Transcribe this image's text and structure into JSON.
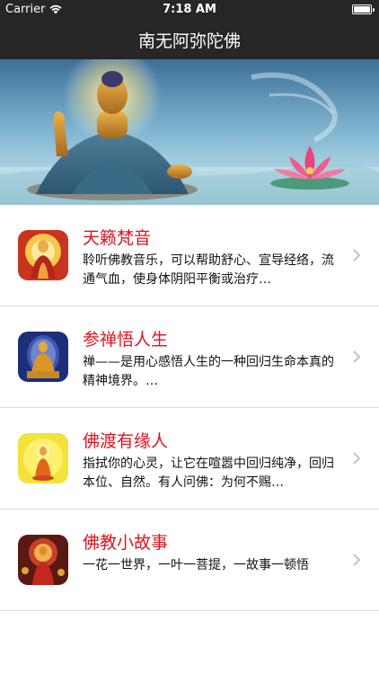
{
  "status": {
    "carrier": "Carrier",
    "time": "7:18 AM"
  },
  "nav": {
    "title": "南无阿弥陀佛"
  },
  "items": [
    {
      "title": "天籁梵音",
      "desc": "聆听佛教音乐，可以帮助舒心、宣导经络，流通气血，使身体阴阳平衡或治疗…",
      "icon": "buddha-thumb-icon"
    },
    {
      "title": "参禅悟人生",
      "desc": "禅——是用心感悟人生的一种回归生命本真的精神境界。…",
      "icon": "golden-buddha-thumb-icon"
    },
    {
      "title": "佛渡有缘人",
      "desc": "指拭你的心灵，让它在喧嚣中回归纯净，回归本位、自然。有人问佛：为何不赐…",
      "icon": "buddha-halo-thumb-icon"
    },
    {
      "title": "佛教小故事",
      "desc": "一花一世界，一叶一菩提，一故事一顿悟",
      "icon": "buddha-story-thumb-icon"
    }
  ],
  "colors": {
    "accent": "#e0141e",
    "bar": "#262626"
  }
}
